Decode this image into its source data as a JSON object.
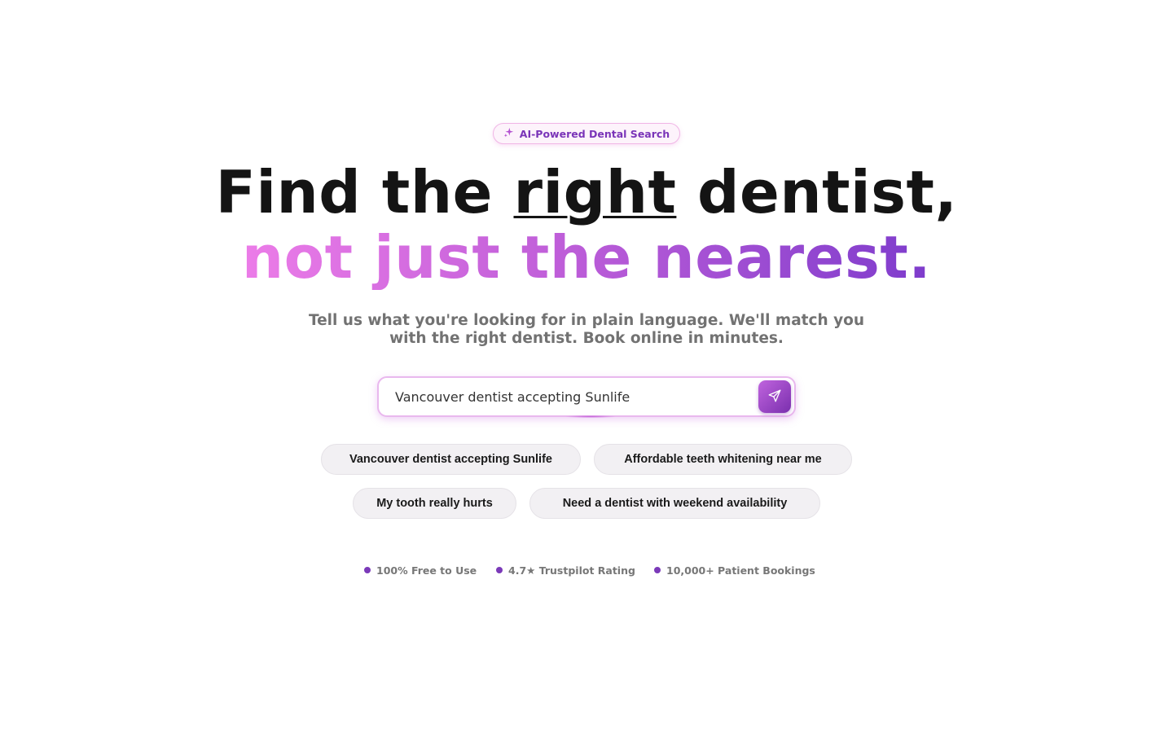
{
  "badge": {
    "icon": "sparkle-icon",
    "label": "AI-Powered Dental Search"
  },
  "headline": {
    "line1_prefix": "Find the ",
    "line1_emphasis": "right",
    "line1_suffix": " dentist,",
    "line2": "not just the nearest."
  },
  "subtitle": "Tell us what you're looking for in plain language. We'll match you with the right dentist. Book online in minutes.",
  "search": {
    "value": "Vancouver dentist accepting Sunlife",
    "submit_icon": "send-icon"
  },
  "suggestions": [
    {
      "label": "Vancouver dentist accepting Sunlife"
    },
    {
      "label": "Affordable teeth whitening near me"
    },
    {
      "label": "My tooth really hurts"
    },
    {
      "label": "Need a dentist with weekend availability"
    }
  ],
  "trust_items": [
    {
      "label": "100% Free to Use"
    },
    {
      "label": "4.7★ Trustpilot Rating"
    },
    {
      "label": "10,000+ Patient Bookings"
    }
  ],
  "colors": {
    "accent": "#7b3ab9",
    "gradient_start": "#ec7ce8",
    "gradient_end": "#7e3ccc",
    "heading": "#141414"
  }
}
